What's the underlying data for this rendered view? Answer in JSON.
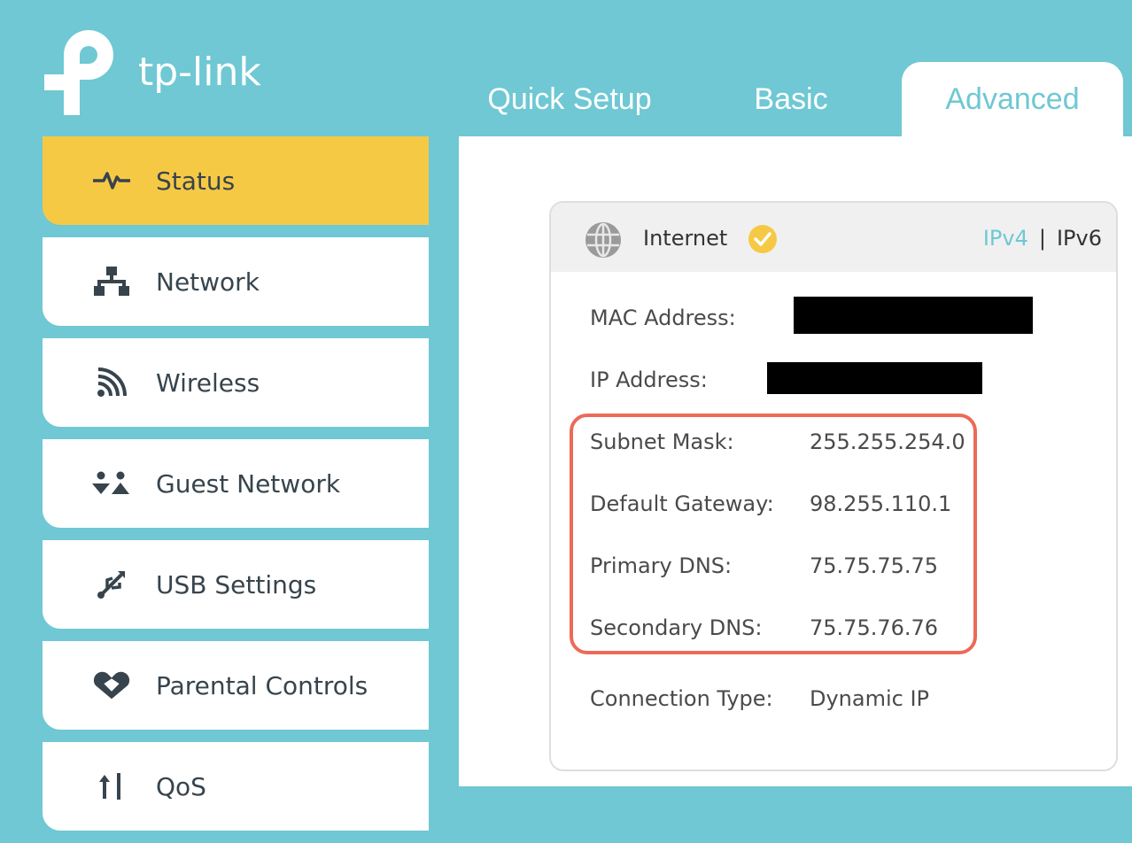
{
  "brand": {
    "name": "tp-link",
    "accent_color": "#6fc8d3",
    "active_color": "#f6c945",
    "highlight_color": "#ec6a58"
  },
  "tabs": [
    {
      "label": "Quick Setup",
      "active": false
    },
    {
      "label": "Basic",
      "active": false
    },
    {
      "label": "Advanced",
      "active": true
    }
  ],
  "sidebar": {
    "items": [
      {
        "label": "Status",
        "icon": "pulse-icon",
        "active": true
      },
      {
        "label": "Network",
        "icon": "network-topology-icon",
        "active": false
      },
      {
        "label": "Wireless",
        "icon": "wifi-signal-icon",
        "active": false
      },
      {
        "label": "Guest Network",
        "icon": "guest-users-icon",
        "active": false
      },
      {
        "label": "USB Settings",
        "icon": "usb-icon",
        "active": false
      },
      {
        "label": "Parental Controls",
        "icon": "heart-icon",
        "active": false
      },
      {
        "label": "QoS",
        "icon": "qos-arrows-icon",
        "active": false
      }
    ]
  },
  "internet_card": {
    "title": "Internet",
    "status": "connected",
    "ip_versions": {
      "v4": "IPv4",
      "separator": "|",
      "v6": "IPv6",
      "selected": "IPv4"
    },
    "fields": [
      {
        "label": "MAC Address:",
        "value": "",
        "redacted": true
      },
      {
        "label": "IP Address:",
        "value": "",
        "redacted": true
      },
      {
        "label": "Subnet Mask:",
        "value": "255.255.254.0"
      },
      {
        "label": "Default Gateway:",
        "value": "98.255.110.1"
      },
      {
        "label": "Primary DNS:",
        "value": "75.75.75.75"
      },
      {
        "label": "Secondary DNS:",
        "value": "75.75.76.76"
      },
      {
        "label": "Connection Type:",
        "value": "Dynamic IP"
      }
    ]
  }
}
